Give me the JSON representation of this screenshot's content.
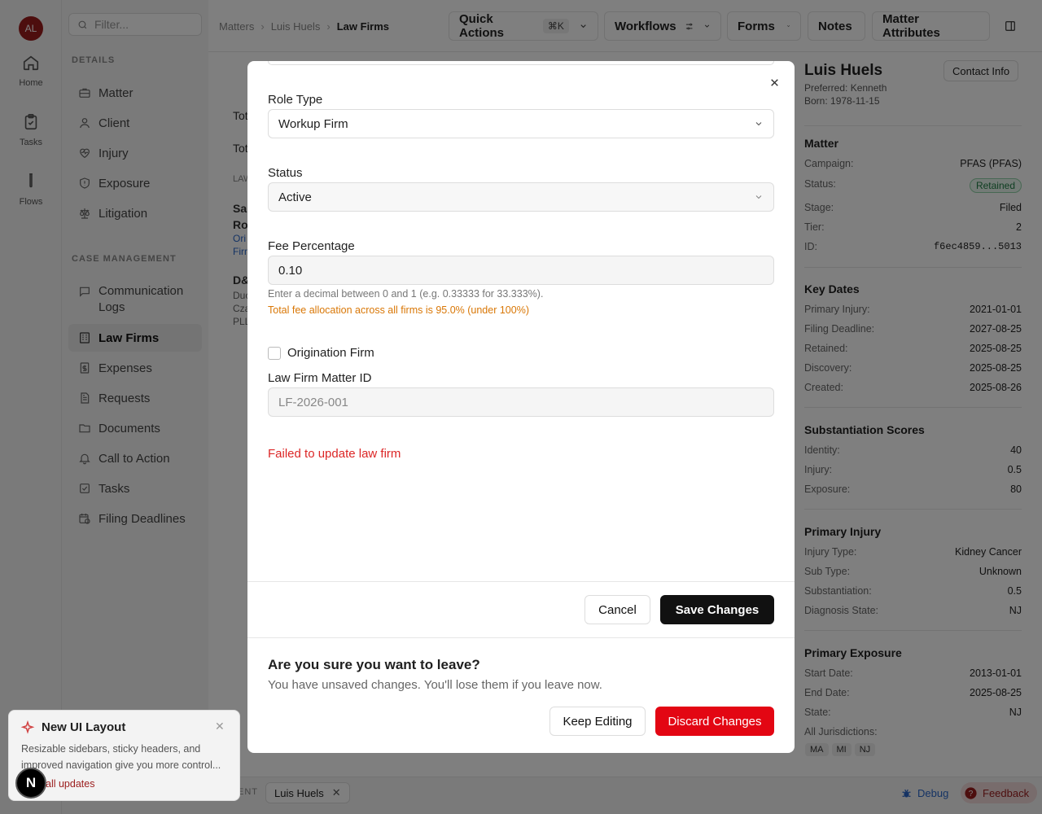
{
  "user": {
    "initials": "AL"
  },
  "rail": [
    {
      "label": "Home",
      "icon": "home-icon"
    },
    {
      "label": "Tasks",
      "icon": "clipboard-icon"
    },
    {
      "label": "Flows",
      "icon": "test-tube-icon"
    }
  ],
  "nav": {
    "filter_placeholder": "Filter...",
    "details_heading": "DETAILS",
    "details_items": [
      "Matter",
      "Client",
      "Injury",
      "Exposure",
      "Litigation"
    ],
    "case_heading": "CASE MANAGEMENT",
    "case_items": [
      "Communication Logs",
      "Law Firms",
      "Expenses",
      "Requests",
      "Documents",
      "Call to Action",
      "Tasks",
      "Filing Deadlines"
    ],
    "active": "Law Firms"
  },
  "breadcrumb": [
    "Matters",
    "Luis Huels",
    "Law Firms"
  ],
  "header": {
    "quick_actions": "Quick Actions",
    "shortcut": "⌘K",
    "workflows": "Workflows",
    "forms": "Forms",
    "notes": "Notes",
    "matter_attributes": "Matter Attributes"
  },
  "background_partial": {
    "lines": [
      "Tot",
      "Tot",
      "LAW",
      "Sa",
      "Ro",
      "Ori",
      "Firm",
      "D&",
      "Duc",
      "Cza",
      "PLL"
    ]
  },
  "client": {
    "name": "Luis Huels",
    "preferred": "Preferred: Kenneth",
    "born": "Born: 1978-11-15",
    "contact_button": "Contact Info"
  },
  "matter": {
    "heading": "Matter",
    "rows": [
      {
        "k": "Campaign:",
        "v": "PFAS (PFAS)"
      },
      {
        "k": "Status:",
        "v": "Retained"
      },
      {
        "k": "Stage:",
        "v": "Filed"
      },
      {
        "k": "Tier:",
        "v": "2"
      },
      {
        "k": "ID:",
        "v": "f6ec4859...5013"
      }
    ]
  },
  "key_dates": {
    "heading": "Key Dates",
    "rows": [
      {
        "k": "Primary Injury:",
        "v": "2021-01-01"
      },
      {
        "k": "Filing Deadline:",
        "v": "2027-08-25"
      },
      {
        "k": "Retained:",
        "v": "2025-08-25"
      },
      {
        "k": "Discovery:",
        "v": "2025-08-25"
      },
      {
        "k": "Created:",
        "v": "2025-08-26"
      }
    ]
  },
  "scores": {
    "heading": "Substantiation Scores",
    "rows": [
      {
        "k": "Identity:",
        "v": "40"
      },
      {
        "k": "Injury:",
        "v": "0.5"
      },
      {
        "k": "Exposure:",
        "v": "80"
      }
    ]
  },
  "primary_injury": {
    "heading": "Primary Injury",
    "rows": [
      {
        "k": "Injury Type:",
        "v": "Kidney Cancer"
      },
      {
        "k": "Sub Type:",
        "v": "Unknown"
      },
      {
        "k": "Substantiation:",
        "v": "0.5"
      },
      {
        "k": "Diagnosis State:",
        "v": "NJ"
      }
    ]
  },
  "primary_exposure": {
    "heading": "Primary Exposure",
    "rows": [
      {
        "k": "Start Date:",
        "v": "2013-01-01"
      },
      {
        "k": "End Date:",
        "v": "2025-08-25"
      },
      {
        "k": "State:",
        "v": "NJ"
      }
    ],
    "jurisdictions_label": "All Jurisdictions:",
    "jurisdictions": [
      "MA",
      "MI",
      "NJ"
    ]
  },
  "bottom": {
    "recent_label": "ENT",
    "tab": "Luis Huels",
    "debug": "Debug",
    "feedback": "Feedback"
  },
  "toast": {
    "title": "New UI Layout",
    "body": "Resizable sidebars, sticky headers, and improved navigation give you more control...",
    "link": "all updates",
    "badge": "N"
  },
  "modal": {
    "role_type_label": "Role Type",
    "role_type_value": "Workup Firm",
    "status_label": "Status",
    "status_value": "Active",
    "fee_label": "Fee Percentage",
    "fee_value": "0.10",
    "fee_help": "Enter a decimal between 0 and 1 (e.g. 0.33333 for 33.333%).",
    "fee_warning": "Total fee allocation across all firms is 95.0% (under 100%)",
    "origination_label": "Origination Firm",
    "origination_checked": false,
    "matter_id_label": "Law Firm Matter ID",
    "matter_id_placeholder": "LF-2026-001",
    "error": "Failed to update law firm",
    "cancel": "Cancel",
    "save": "Save Changes",
    "confirm_title": "Are you sure you want to leave?",
    "confirm_text": "You have unsaved changes. You'll lose them if you leave now.",
    "keep_editing": "Keep Editing",
    "discard": "Discard Changes"
  },
  "colors": {
    "danger": "#e30613",
    "warning": "#d97706",
    "brand": "#9b1c1c",
    "link": "#2a67c9"
  }
}
